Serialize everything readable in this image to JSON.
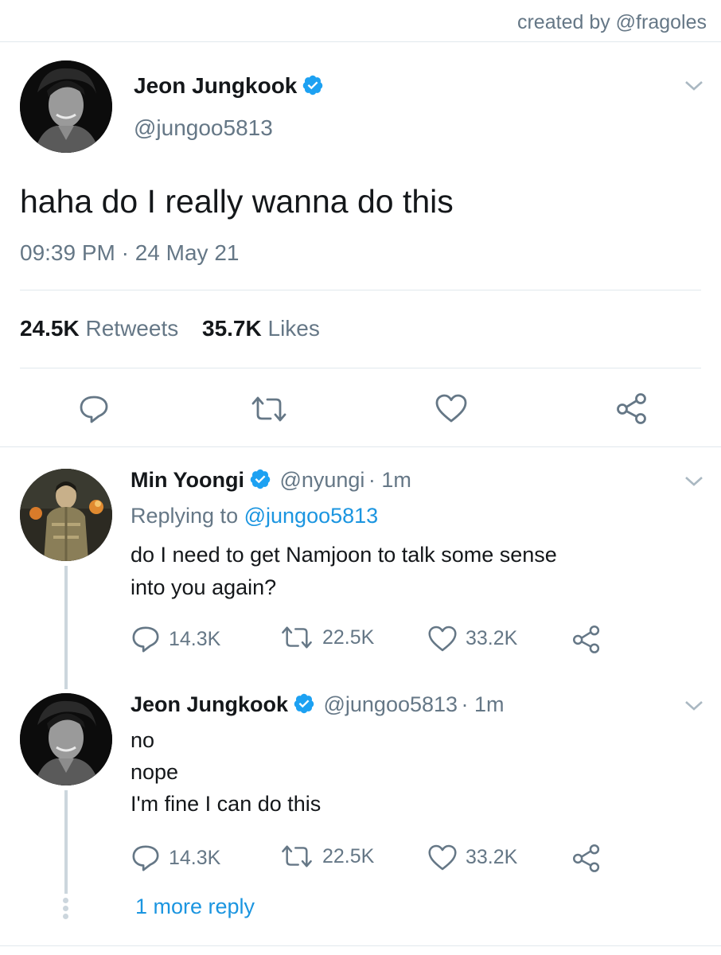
{
  "credit": "created by @fragoles",
  "main_tweet": {
    "name": "Jeon Jungkook",
    "handle": "@jungoo5813",
    "text": "haha do I really wanna do this",
    "timestamp": "09:39 PM · 24 May 21",
    "retweets_count": "24.5K",
    "retweets_label": "Retweets",
    "likes_count": "35.7K",
    "likes_label": "Likes"
  },
  "replies": [
    {
      "name": "Min Yoongi",
      "handle": "@nyungi",
      "time": "· 1m",
      "replying_prefix": "Replying to",
      "replying_to": "@jungoo5813",
      "line1": "do I need to get Namjoon to talk some sense",
      "line2": "into you again?",
      "replies": "14.3K",
      "retweets": "22.5K",
      "likes": "33.2K"
    },
    {
      "name": "Jeon Jungkook",
      "handle": "@jungoo5813",
      "time": "· 1m",
      "line1": "no",
      "line2": "nope",
      "line3": "I'm fine I can do this",
      "replies": "14.3K",
      "retweets": "22.5K",
      "likes": "33.2K"
    }
  ],
  "more_replies": "1 more reply",
  "colors": {
    "accent": "#1b95e0",
    "secondary_text": "#657786",
    "divider": "#e1e8ed",
    "thread_line": "#ccd6dd"
  }
}
